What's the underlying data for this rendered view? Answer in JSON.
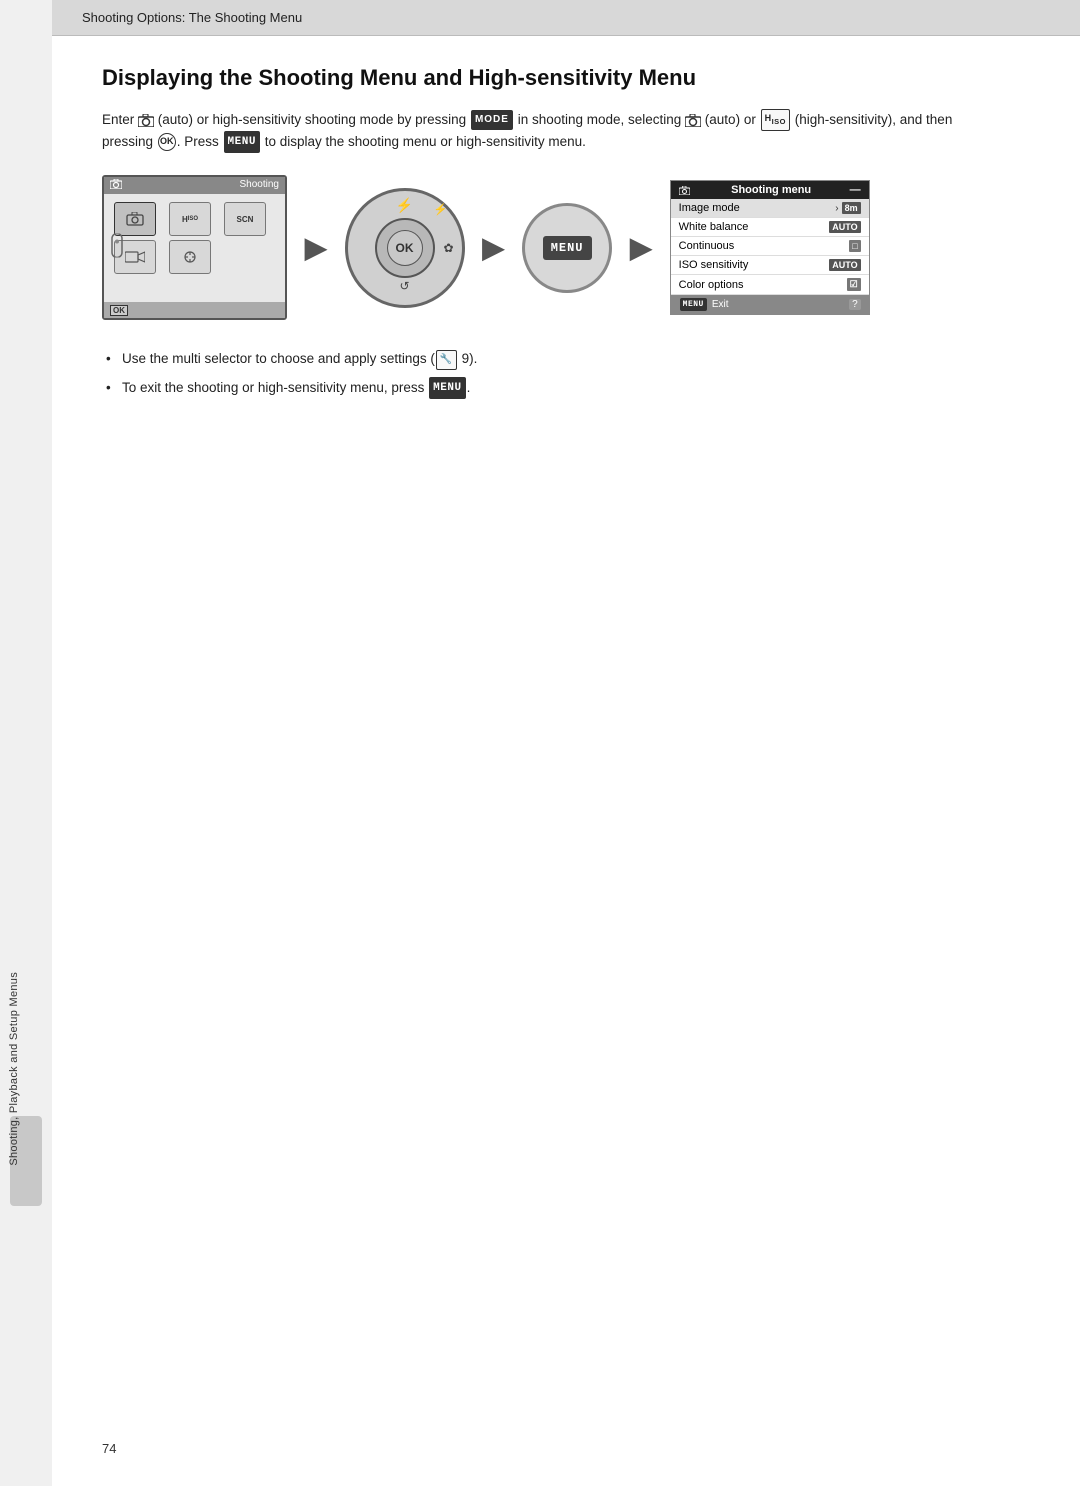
{
  "header": {
    "breadcrumb": "Shooting Options: The Shooting Menu"
  },
  "page": {
    "title": "Displaying the Shooting Menu and High-sensitivity Menu",
    "body_paragraph": "Enter  (auto) or high-sensitivity shooting mode by pressing MODE in shooting mode, selecting  (auto) or  (high-sensitivity), and then pressing OK. Press MENU to display the shooting menu or high-sensitivity menu.",
    "bullet1": "Use the multi selector to choose and apply settings (",
    "bullet1_ref": "9).",
    "bullet2": "To exit the shooting or high-sensitivity menu, press",
    "bullet2_end": ".",
    "page_number": "74"
  },
  "sidebar": {
    "label": "Shooting, Playback and Setup Menus"
  },
  "diagram": {
    "screen_label": "Shooting",
    "screen_icon1": "▲",
    "menu_title": "Shooting menu",
    "menu_items": [
      {
        "label": "Image mode",
        "badge": "8m",
        "arrow": true,
        "highlight": true
      },
      {
        "label": "White balance",
        "badge": "AUTO",
        "arrow": false
      },
      {
        "label": "Continuous",
        "badge": "□",
        "arrow": false
      },
      {
        "label": "ISO sensitivity",
        "badge": "AUTO",
        "arrow": false
      },
      {
        "label": "Color options",
        "badge": "☑",
        "arrow": false
      }
    ],
    "menu_footer": "MENU Exit"
  },
  "icons": {
    "mode_btn": "MODE",
    "ok_btn": "OK",
    "menu_btn": "MENU"
  }
}
